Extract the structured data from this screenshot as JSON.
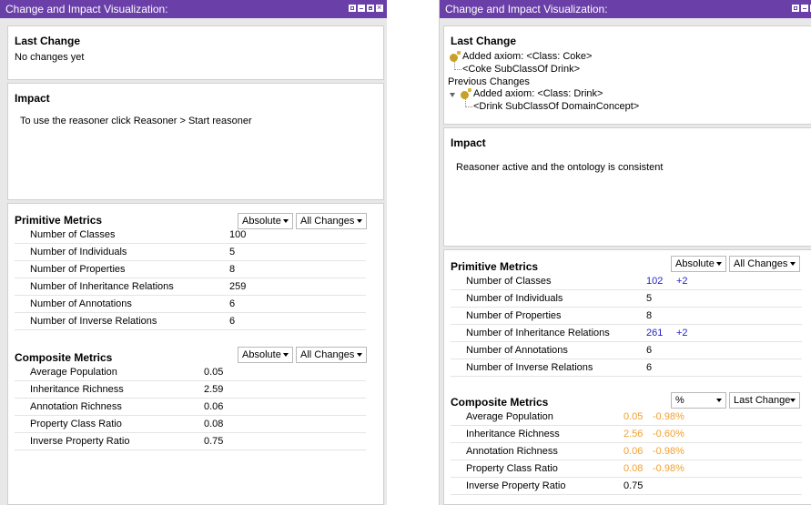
{
  "colors": {
    "titlebar": "#6a3fa8",
    "delta_positive": "#2222cc",
    "delta_negative": "#f0a030"
  },
  "left": {
    "title": "Change and Impact Visualization:",
    "last_change": {
      "heading": "Last Change",
      "text": "No changes yet"
    },
    "impact": {
      "heading": "Impact",
      "text": "To use the reasoner click Reasoner > Start reasoner"
    },
    "primitive": {
      "heading": "Primitive Metrics",
      "mode": "Absolute",
      "scope": "All Changes",
      "rows": [
        {
          "name": "Number of Classes",
          "value": "100"
        },
        {
          "name": "Number of Individuals",
          "value": "5"
        },
        {
          "name": "Number of Properties",
          "value": "8"
        },
        {
          "name": "Number of Inheritance Relations",
          "value": "259"
        },
        {
          "name": "Number of Annotations",
          "value": "6"
        },
        {
          "name": "Number of Inverse Relations",
          "value": "6"
        }
      ]
    },
    "composite": {
      "heading": "Composite Metrics",
      "mode": "Absolute",
      "scope": "All Changes",
      "rows": [
        {
          "name": "Average Population",
          "value": "0.05"
        },
        {
          "name": "Inheritance Richness",
          "value": "2.59"
        },
        {
          "name": "Annotation Richness",
          "value": "0.06"
        },
        {
          "name": "Property Class Ratio",
          "value": "0.08"
        },
        {
          "name": "Inverse Property Ratio",
          "value": "0.75"
        }
      ]
    }
  },
  "right": {
    "title": "Change and Impact Visualization:",
    "last_change": {
      "heading": "Last Change",
      "axiom": "Added axiom: <Class: Coke>",
      "axiom_detail": "<Coke SubClassOf Drink>",
      "previous_heading": "Previous Changes",
      "prev_axiom": "Added axiom: <Class: Drink>",
      "prev_detail": "<Drink SubClassOf DomainConcept>"
    },
    "impact": {
      "heading": "Impact",
      "text": "Reasoner active and the ontology is consistent"
    },
    "primitive": {
      "heading": "Primitive Metrics",
      "mode": "Absolute",
      "scope": "All Changes",
      "rows": [
        {
          "name": "Number of Classes",
          "value": "102",
          "delta": "+2"
        },
        {
          "name": "Number of Individuals",
          "value": "5",
          "delta": ""
        },
        {
          "name": "Number of Properties",
          "value": "8",
          "delta": ""
        },
        {
          "name": "Number of Inheritance Relations",
          "value": "261",
          "delta": "+2"
        },
        {
          "name": "Number of Annotations",
          "value": "6",
          "delta": ""
        },
        {
          "name": "Number of Inverse Relations",
          "value": "6",
          "delta": ""
        }
      ]
    },
    "composite": {
      "heading": "Composite Metrics",
      "mode": "%",
      "scope": "Last Change",
      "rows": [
        {
          "name": "Average Population",
          "value": "0.05",
          "delta": "-0.98%"
        },
        {
          "name": "Inheritance Richness",
          "value": "2.56",
          "delta": "-0.60%"
        },
        {
          "name": "Annotation Richness",
          "value": "0.06",
          "delta": "-0.98%"
        },
        {
          "name": "Property Class Ratio",
          "value": "0.08",
          "delta": "-0.98%"
        },
        {
          "name": "Inverse Property Ratio",
          "value": "0.75",
          "delta": ""
        }
      ]
    }
  }
}
